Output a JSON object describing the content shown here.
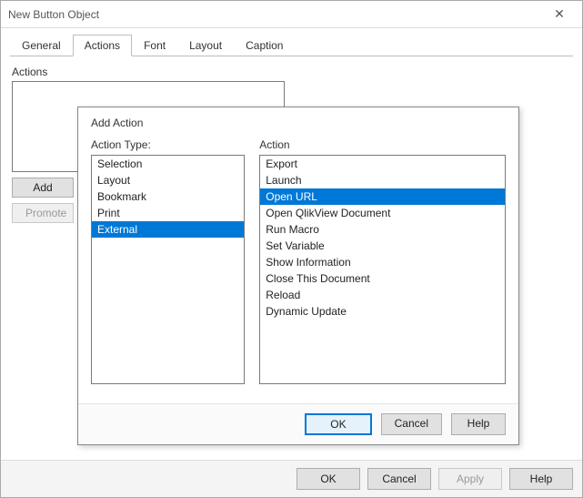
{
  "window": {
    "title": "New Button Object",
    "close_glyph": "✕"
  },
  "tabs": [
    {
      "label": "General"
    },
    {
      "label": "Actions",
      "active": true
    },
    {
      "label": "Font"
    },
    {
      "label": "Layout"
    },
    {
      "label": "Caption"
    }
  ],
  "actions_panel": {
    "label": "Actions",
    "add_label": "Add",
    "promote_label": "Promote"
  },
  "footer": {
    "ok": "OK",
    "cancel": "Cancel",
    "apply": "Apply",
    "help": "Help"
  },
  "modal": {
    "title": "Add Action",
    "action_type_label": "Action Type:",
    "action_label": "Action",
    "action_types": [
      {
        "label": "Selection"
      },
      {
        "label": "Layout"
      },
      {
        "label": "Bookmark"
      },
      {
        "label": "Print"
      },
      {
        "label": "External",
        "selected": true
      }
    ],
    "actions": [
      {
        "label": "Export"
      },
      {
        "label": "Launch"
      },
      {
        "label": "Open URL",
        "selected": true
      },
      {
        "label": "Open QlikView Document"
      },
      {
        "label": "Run Macro"
      },
      {
        "label": "Set Variable"
      },
      {
        "label": "Show Information"
      },
      {
        "label": "Close This Document"
      },
      {
        "label": "Reload"
      },
      {
        "label": "Dynamic Update"
      }
    ],
    "footer": {
      "ok": "OK",
      "cancel": "Cancel",
      "help": "Help"
    }
  }
}
